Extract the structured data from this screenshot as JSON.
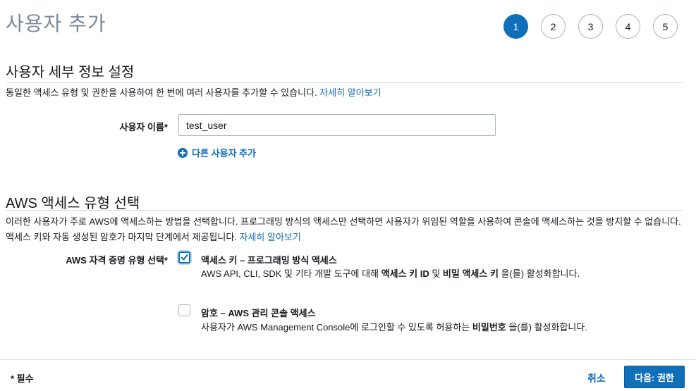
{
  "page": {
    "title": "사용자 추가"
  },
  "steps": [
    "1",
    "2",
    "3",
    "4",
    "5"
  ],
  "details": {
    "heading": "사용자 세부 정보 설정",
    "description": "동일한 액세스 유형 및 권한을 사용하여 한 번에 여러 사용자를 추가할 수 있습니다. ",
    "learn_more": "자세히 알아보기",
    "username_label": "사용자 이름*",
    "username_value": "test_user",
    "add_another": "다른 사용자 추가"
  },
  "access": {
    "heading": "AWS 액세스 유형 선택",
    "description": "이러한 사용자가 주로 AWS에 액세스하는 방법을 선택합니다. 프로그래밍 방식의 액세스만 선택하면 사용자가 위임된 역할을 사용하여 콘솔에 액세스하는 것을 방지할 수 없습니다. 액세스 키와 자동 생성된 암호가 마지막 단계에서 제공됩니다. ",
    "learn_more": "자세히 알아보기",
    "credential_label": "AWS 자격 증명 유형 선택*",
    "options": [
      {
        "title": "액세스 키 – 프로그래밍 방식 액세스",
        "desc_pre": "AWS API, CLI, SDK 및 기타 개발 도구에 대해 ",
        "bold1": "액세스 키 ID",
        "mid": " 및 ",
        "bold2": "비밀 액세스 키",
        "desc_post": " 을(를) 활성화합니다.",
        "checked": true
      },
      {
        "title": "암호 – AWS 관리 콘솔 액세스",
        "desc_pre": "사용자가 AWS Management Console에 로그인할 수 있도록 허용하는 ",
        "bold1": "비밀번호",
        "desc_post": " 을(를) 활성화합니다.",
        "checked": false
      }
    ]
  },
  "footer": {
    "required": "* 필수",
    "cancel": "취소",
    "next": "다음: 권한"
  },
  "colors": {
    "accent": "#0f6fb8",
    "title_gray": "#7d8998"
  }
}
